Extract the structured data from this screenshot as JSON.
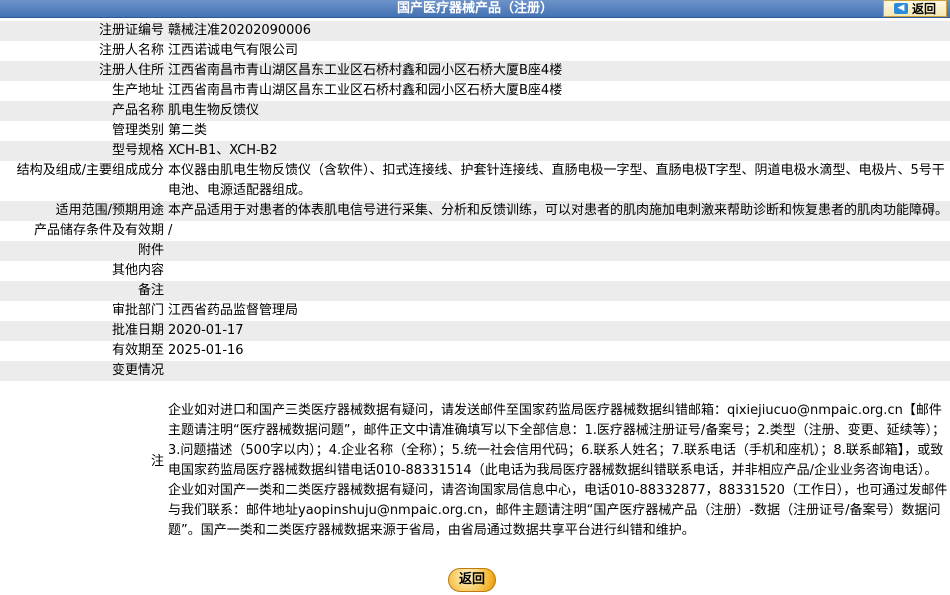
{
  "header": {
    "title": "国产医疗器械产品（注册）",
    "back_label": "返回"
  },
  "rows": [
    {
      "label": "注册证编号",
      "value": "赣械注准20202090006"
    },
    {
      "label": "注册人名称",
      "value": "江西诺诚电气有限公司"
    },
    {
      "label": "注册人住所",
      "value": "江西省南昌市青山湖区昌东工业区石桥村鑫和园小区石桥大厦B座4楼"
    },
    {
      "label": "生产地址",
      "value": "江西省南昌市青山湖区昌东工业区石桥村鑫和园小区石桥大厦B座4楼"
    },
    {
      "label": "产品名称",
      "value": "肌电生物反馈仪"
    },
    {
      "label": "管理类别",
      "value": "第二类"
    },
    {
      "label": "型号规格",
      "value": "XCH-B1、XCH-B2"
    },
    {
      "label": "结构及组成/主要组成成分",
      "value": "本仪器由肌电生物反馈仪（含软件）、扣式连接线、护套针连接线、直肠电极一字型、直肠电极T字型、阴道电极水滴型、电极片、5号干电池、电源适配器组成。"
    },
    {
      "label": "适用范围/预期用途",
      "value": "本产品适用于对患者的体表肌电信号进行采集、分析和反馈训练，可以对患者的肌肉施加电刺激来帮助诊断和恢复患者的肌肉功能障碍。"
    },
    {
      "label": "产品储存条件及有效期",
      "value": "/"
    },
    {
      "label": "附件",
      "value": ""
    },
    {
      "label": "其他内容",
      "value": ""
    },
    {
      "label": "备注",
      "value": ""
    },
    {
      "label": "审批部门",
      "value": "江西省药品监督管理局"
    },
    {
      "label": "批准日期",
      "value": "2020-01-17"
    },
    {
      "label": "有效期至",
      "value": "2025-01-16"
    },
    {
      "label": "变更情况",
      "value": ""
    }
  ],
  "note": {
    "label": "注",
    "value": "企业如对进口和国产三类医疗器械数据有疑问，请发送邮件至国家药监局医疗器械数据纠错邮箱：qixiejiucuo@nmpaic.org.cn【邮件主题请注明“医疗器械数据问题”，邮件正文中请准确填写以下全部信息：1.医疗器械注册证号/备案号；2.类型（注册、变更、延续等）；3.问题描述（500字以内）；4.企业名称（全称）；5.统一社会信用代码；6.联系人姓名；7.联系电话（手机和座机）；8.联系邮箱】，或致电国家药监局医疗器械数据纠错电话010-88331514（此电话为我局医疗器械数据纠错联系电话，并非相应产品/企业业务咨询电话）。企业如对国产一类和二类医疗器械数据有疑问，请咨询国家局信息中心，电话010-88332877，88331520（工作日），也可通过发邮件与我们联系：邮件地址yaopinshuju@nmpaic.org.cn，邮件主题请注明“国产医疗器械产品（注册）-数据（注册证号/备案号）数据问题”。国产一类和二类医疗器械数据来源于省局，由省局通过数据共享平台进行纠错和维护。"
  },
  "footer": {
    "back_label": "返回"
  }
}
